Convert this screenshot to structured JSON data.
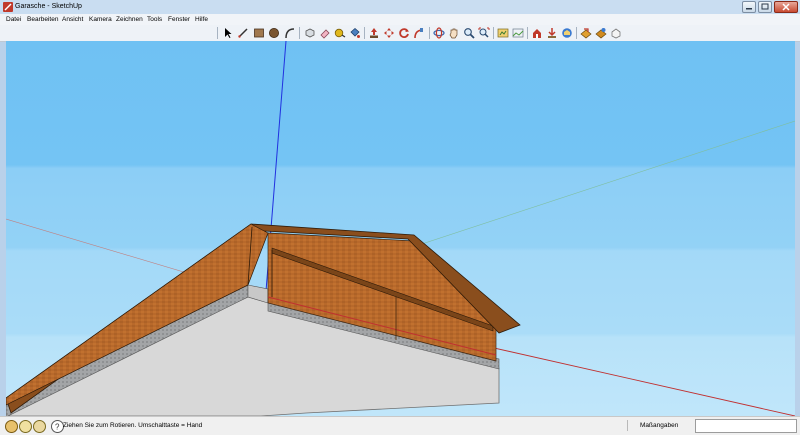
{
  "window": {
    "title": "Garasche - SketchUp"
  },
  "menu": [
    "Datei",
    "Bearbeiten",
    "Ansicht",
    "Kamera",
    "Zeichnen",
    "Tools",
    "Fenster",
    "Hilfe"
  ],
  "toolbar": {
    "tools": [
      "select-icon",
      "line-icon",
      "rectangle-icon",
      "circle-icon",
      "arc-icon",
      "make-component-icon",
      "eraser-icon",
      "tape-measure-icon",
      "paint-bucket-icon",
      "push-pull-icon",
      "move-icon",
      "rotate-icon",
      "follow-me-icon",
      "orbit-icon",
      "pan-icon",
      "zoom-icon",
      "zoom-extents-icon",
      "add-location-icon",
      "toggle-terrain-icon",
      "preview-google-earth-icon",
      "get-models-icon",
      "share-model-icon",
      "share-component-icon",
      "google-earth-icon",
      "extension-warehouse-icon",
      "sandbox-icon"
    ]
  },
  "colors": {
    "sky_top": "#7bc4f2",
    "sky_bottom": "#b3e0fa",
    "ground": "#d6d6d6",
    "wood": "#b5692a",
    "wood_dark": "#6e3d16",
    "foundation": "#9ea0a2",
    "axis_blue": "#2030e0",
    "axis_red": "#c03030",
    "axis_green": "#58b070"
  },
  "status": {
    "icons": [
      "geo-location-icon",
      "credits-icon",
      "user-icon",
      "help-icon"
    ],
    "message": "Ziehen Sie zum Rotieren.  Umschalttaste = Hand",
    "measurements_label": "Maßangaben",
    "measurements_value": ""
  }
}
